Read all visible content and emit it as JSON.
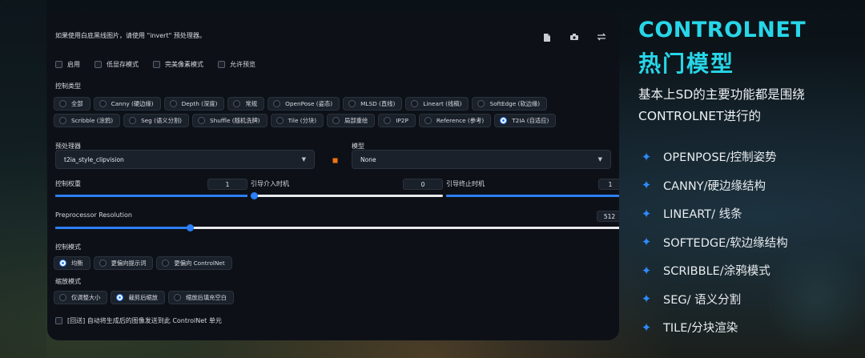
{
  "panel": {
    "hint": "如果使用白底黑线图片，请使用 \"invert\" 预处理器。",
    "toolbar_icons": [
      "document-icon",
      "camera-icon",
      "swap-icon"
    ],
    "checkboxes": [
      {
        "label": "启用",
        "checked": false
      },
      {
        "label": "低显存模式",
        "checked": false
      },
      {
        "label": "完美像素模式",
        "checked": false
      },
      {
        "label": "允许预览",
        "checked": false
      }
    ],
    "control_type_label": "控制类型",
    "control_types": [
      {
        "label": "全部",
        "selected": false
      },
      {
        "label": "Canny (硬边缘)",
        "selected": false
      },
      {
        "label": "Depth (深度)",
        "selected": false
      },
      {
        "label": "常规",
        "selected": false
      },
      {
        "label": "OpenPose (姿态)",
        "selected": false
      },
      {
        "label": "MLSD (直线)",
        "selected": false
      },
      {
        "label": "Lineart (线稿)",
        "selected": false
      },
      {
        "label": "SoftEdge (软边缘)",
        "selected": false
      },
      {
        "label": "Scribble (涂鸦)",
        "selected": false
      },
      {
        "label": "Seg (语义分割)",
        "selected": false
      },
      {
        "label": "Shuffle (随机洗牌)",
        "selected": false
      },
      {
        "label": "Tile (分块)",
        "selected": false
      },
      {
        "label": "局部重绘",
        "selected": false
      },
      {
        "label": "IP2P",
        "selected": false
      },
      {
        "label": "Reference (参考)",
        "selected": false
      },
      {
        "label": "T2IA (自适应)",
        "selected": true
      }
    ],
    "preprocessor_label": "预处理器",
    "preprocessor_value": "t2ia_style_clipvision",
    "model_label": "模型",
    "model_value": "None",
    "weight_label": "控制权重",
    "weight_value": "1",
    "weight_fraction": 0.0,
    "start_label": "引导介入时机",
    "start_value": "0",
    "start_fraction": 0.0,
    "end_label": "引导终止时机",
    "end_value": "1",
    "end_fraction": 1.0,
    "resolution_label": "Preprocessor Resolution",
    "resolution_value": "512",
    "resolution_fraction": 0.24,
    "control_mode_label": "控制模式",
    "control_modes": [
      {
        "label": "均衡",
        "selected": true
      },
      {
        "label": "更偏向提示词",
        "selected": false
      },
      {
        "label": "更偏向 ControlNet",
        "selected": false
      }
    ],
    "resize_mode_label": "缩放模式",
    "resize_modes": [
      {
        "label": "仅调整大小",
        "selected": false
      },
      {
        "label": "裁剪后缩放",
        "selected": true
      },
      {
        "label": "缩放后填充空白",
        "selected": false
      }
    ],
    "loopback_label": "[回送] 自动将生成后的图像发送到此 ControlNet 单元",
    "loopback_checked": false
  },
  "side": {
    "title_en": "CONTROLNET",
    "title_cn": "热门模型",
    "subtitle": "基本上SD的主要功能都是围绕CONTROLNET进行的",
    "features": [
      "OPENPOSE/控制姿势",
      "CANNY/硬边缘结构",
      "LINEART/ 线条",
      "SOFTEDGE/软边缘结构",
      "SCRIBBLE/涂鸦模式",
      "SEG/ 语义分割",
      "TILE/分块渲染"
    ],
    "title_color": "#27d6e8",
    "star_color": "#2d8bff"
  }
}
